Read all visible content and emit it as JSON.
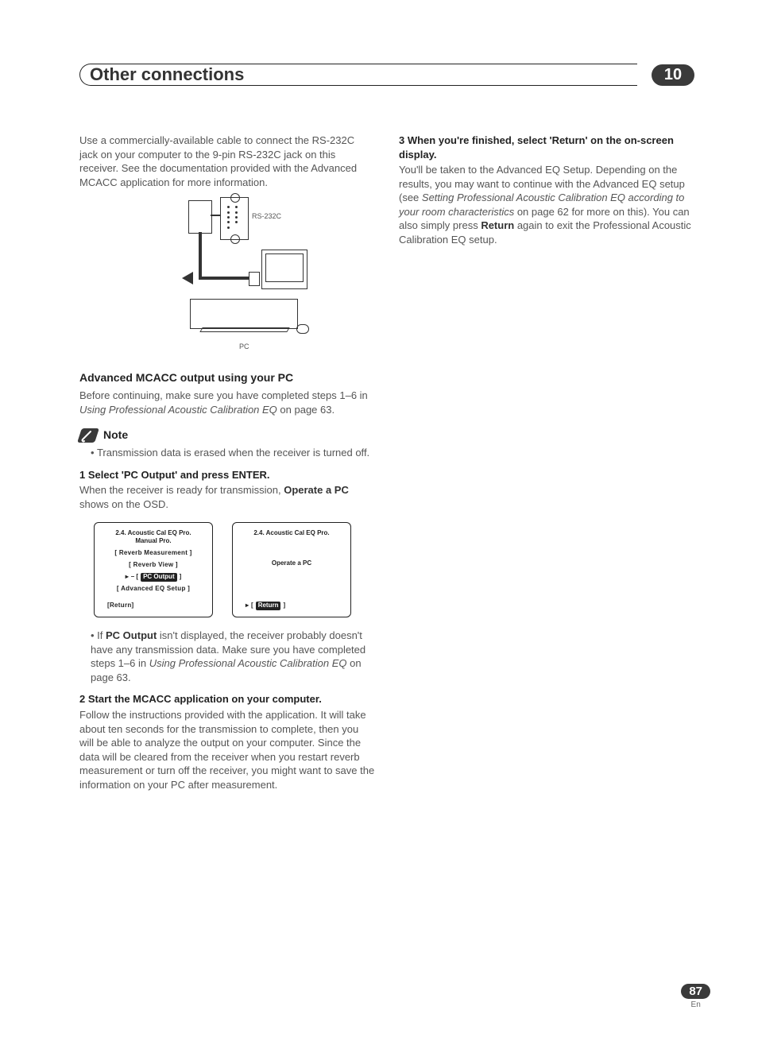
{
  "header": {
    "title": "Other connections",
    "chapter": "10"
  },
  "left": {
    "intro": "Use a commercially-available cable to connect the RS-232C jack on your computer to the 9-pin RS-232C jack on this receiver. See the documentation provided with the Advanced MCACC application for more information.",
    "diagram": {
      "port_label": "RS-232C",
      "pc_label": "PC"
    },
    "h_advanced": "Advanced MCACC output using your PC",
    "advanced_intro_a": "Before continuing, make sure you have completed steps 1–6 in ",
    "advanced_intro_italic": "Using Professional Acoustic Calibration EQ",
    "advanced_intro_b": " on page 63.",
    "note_label": "Note",
    "note_bullet": "Transmission data is erased when the receiver is turned off.",
    "step1": "1   Select 'PC Output' and press ENTER.",
    "step1_body_a": "When the receiver is ready for transmission, ",
    "step1_body_bold": "Operate a PC",
    "step1_body_b": " shows on the OSD.",
    "osd_left": {
      "title1": "2.4. Acoustic  Cal  EQ  Pro.",
      "title2": "Manual  Pro.",
      "item1": "[ Reverb  Measurement ]",
      "item2": "[ Reverb  View ]",
      "sel_prefix": "– [",
      "sel": " PC  Output ",
      "sel_suffix": "]",
      "item3": "[ Advanced  EQ  Setup ]",
      "return": "[Return]"
    },
    "osd_right": {
      "title": "2.4. Acoustic  Cal  EQ  Pro.",
      "msg": "Operate a PC",
      "return_prefix": "[ ",
      "return_sel": "Return",
      "return_suffix": "]"
    },
    "bullet2_a": "If ",
    "bullet2_bold": "PC Output",
    "bullet2_b": " isn't displayed, the receiver probably doesn't have any transmission data. Make sure you have completed steps 1–6 in ",
    "bullet2_italic": "Using Professional Acoustic Calibration EQ",
    "bullet2_c": " on page 63.",
    "step2": "2   Start the MCACC application on your computer.",
    "step2_body": "Follow the instructions provided with the application. It will take about ten seconds for the transmission to complete, then you will be able to analyze the output on your computer. Since the data will be cleared from the receiver when you restart reverb measurement or turn off the receiver, you might want to save the information on your PC after measurement."
  },
  "right": {
    "step3": "3   When you're finished, select 'Return' on the on-screen display.",
    "step3_a": "You'll be taken to the Advanced EQ Setup. Depending on the results, you may want to continue with the Advanced EQ setup (see ",
    "step3_italic": "Setting Professional Acoustic Calibration EQ according to your room characteristics",
    "step3_b": " on page 62 for more on this). You can also simply press ",
    "step3_bold": "Return",
    "step3_c": " again to exit the Professional Acoustic Calibration EQ setup."
  },
  "footer": {
    "page": "87",
    "lang": "En"
  }
}
